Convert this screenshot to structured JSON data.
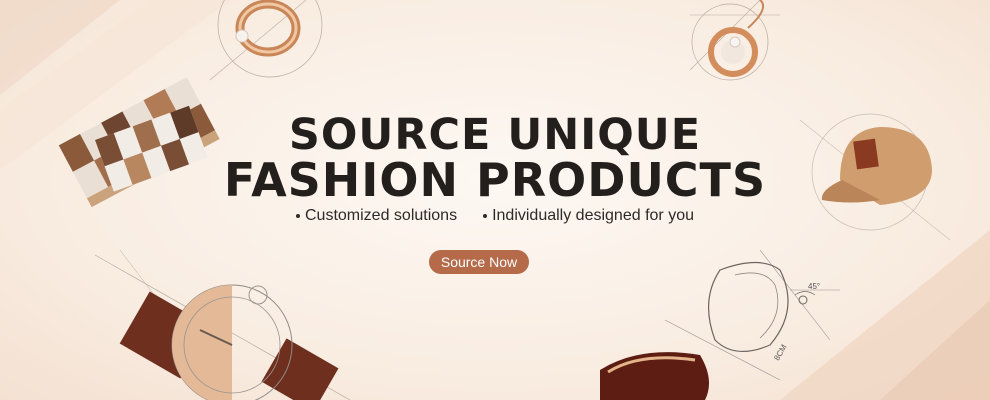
{
  "banner": {
    "headline_line1": "SOURCE UNIQUE",
    "headline_line2": "FASHION PRODUCTS",
    "bullets": [
      "Customized solutions",
      "Individually designed for you"
    ],
    "cta_label": "Source Now",
    "sketch_labels": {
      "angle": "45°",
      "length": "8CM"
    }
  },
  "colors": {
    "accent": "#b56a4a",
    "text": "#231f1d",
    "background": "#fbf1e8"
  },
  "icons": [
    "ring-icon",
    "necklace-icon",
    "scarf-icon",
    "cap-icon",
    "watch-icon",
    "sunglasses-icon"
  ]
}
